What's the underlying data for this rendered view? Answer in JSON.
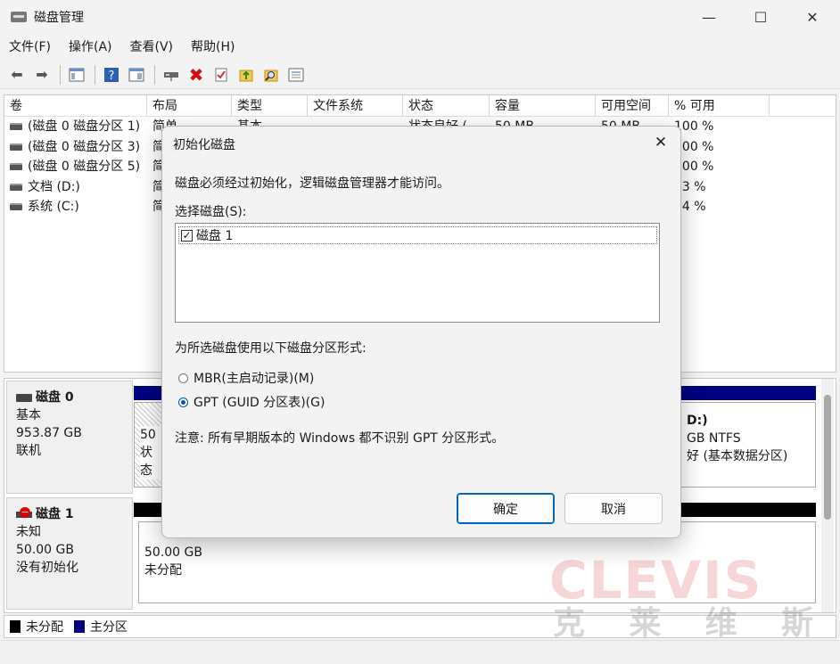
{
  "window": {
    "title": "磁盘管理",
    "minimize": "—",
    "maximize": "☐",
    "close": "✕"
  },
  "menu": [
    {
      "label": "文件",
      "key": "(F)"
    },
    {
      "label": "操作",
      "key": "(A)"
    },
    {
      "label": "查看",
      "key": "(V)"
    },
    {
      "label": "帮助",
      "key": "(H)"
    }
  ],
  "volume_table": {
    "columns": [
      "卷",
      "布局",
      "类型",
      "文件系统",
      "状态",
      "容量",
      "可用空间",
      "% 可用"
    ],
    "rows": [
      [
        "(磁盘 0 磁盘分区 1)",
        "简单",
        "基本",
        "",
        "状态良好 (",
        "50 MB",
        "50 MB",
        "100 %"
      ],
      [
        "(磁盘 0 磁盘分区 3)",
        "简",
        "",
        "",
        "",
        "",
        "",
        "100 %"
      ],
      [
        "(磁盘 0 磁盘分区 5)",
        "简",
        "",
        "",
        "",
        "",
        "",
        "100 %"
      ],
      [
        "文档 (D:)",
        "简",
        "",
        "",
        "",
        "",
        "",
        "33 %"
      ],
      [
        "系统 (C:)",
        "简",
        "",
        "",
        "",
        "",
        "",
        "54 %"
      ]
    ]
  },
  "disks": [
    {
      "name": "磁盘 0",
      "type": "基本",
      "size": "953.87 GB",
      "state": "联机",
      "part_left_size": "50",
      "part_left_status": "状态",
      "part_right_title": "D:)",
      "part_right_fs": "GB NTFS",
      "part_right_status": "好 (基本数据分区)"
    },
    {
      "name": "磁盘 1",
      "type": "未知",
      "size": "50.00 GB",
      "state": "没有初始化",
      "unalloc_size": "50.00 GB",
      "unalloc_label": "未分配"
    }
  ],
  "legend": [
    {
      "label": "未分配",
      "color": "#000000"
    },
    {
      "label": "主分区",
      "color": "#000080"
    }
  ],
  "watermark": {
    "brand": "CLEVIS",
    "cn": [
      "克",
      "莱",
      "维",
      "斯"
    ]
  },
  "dialog": {
    "title": "初始化磁盘",
    "message": "磁盘必须经过初始化，逻辑磁盘管理器才能访问。",
    "select_label": "选择磁盘",
    "select_key": "(S):",
    "disk_item": "磁盘 1",
    "disk_checked": true,
    "partition_style_label": "为所选磁盘使用以下磁盘分区形式:",
    "options": [
      {
        "label": "MBR(主启动记录)",
        "key": "(M)",
        "selected": false
      },
      {
        "label": "GPT (GUID 分区表)",
        "key": "(G)",
        "selected": true
      }
    ],
    "note": "注意: 所有早期版本的 Windows 都不识别 GPT 分区形式。",
    "ok_label": "确定",
    "cancel_label": "取消"
  },
  "colors": {
    "accent": "#0067c0",
    "primary_partition": "#000080",
    "unallocated": "#000000"
  }
}
